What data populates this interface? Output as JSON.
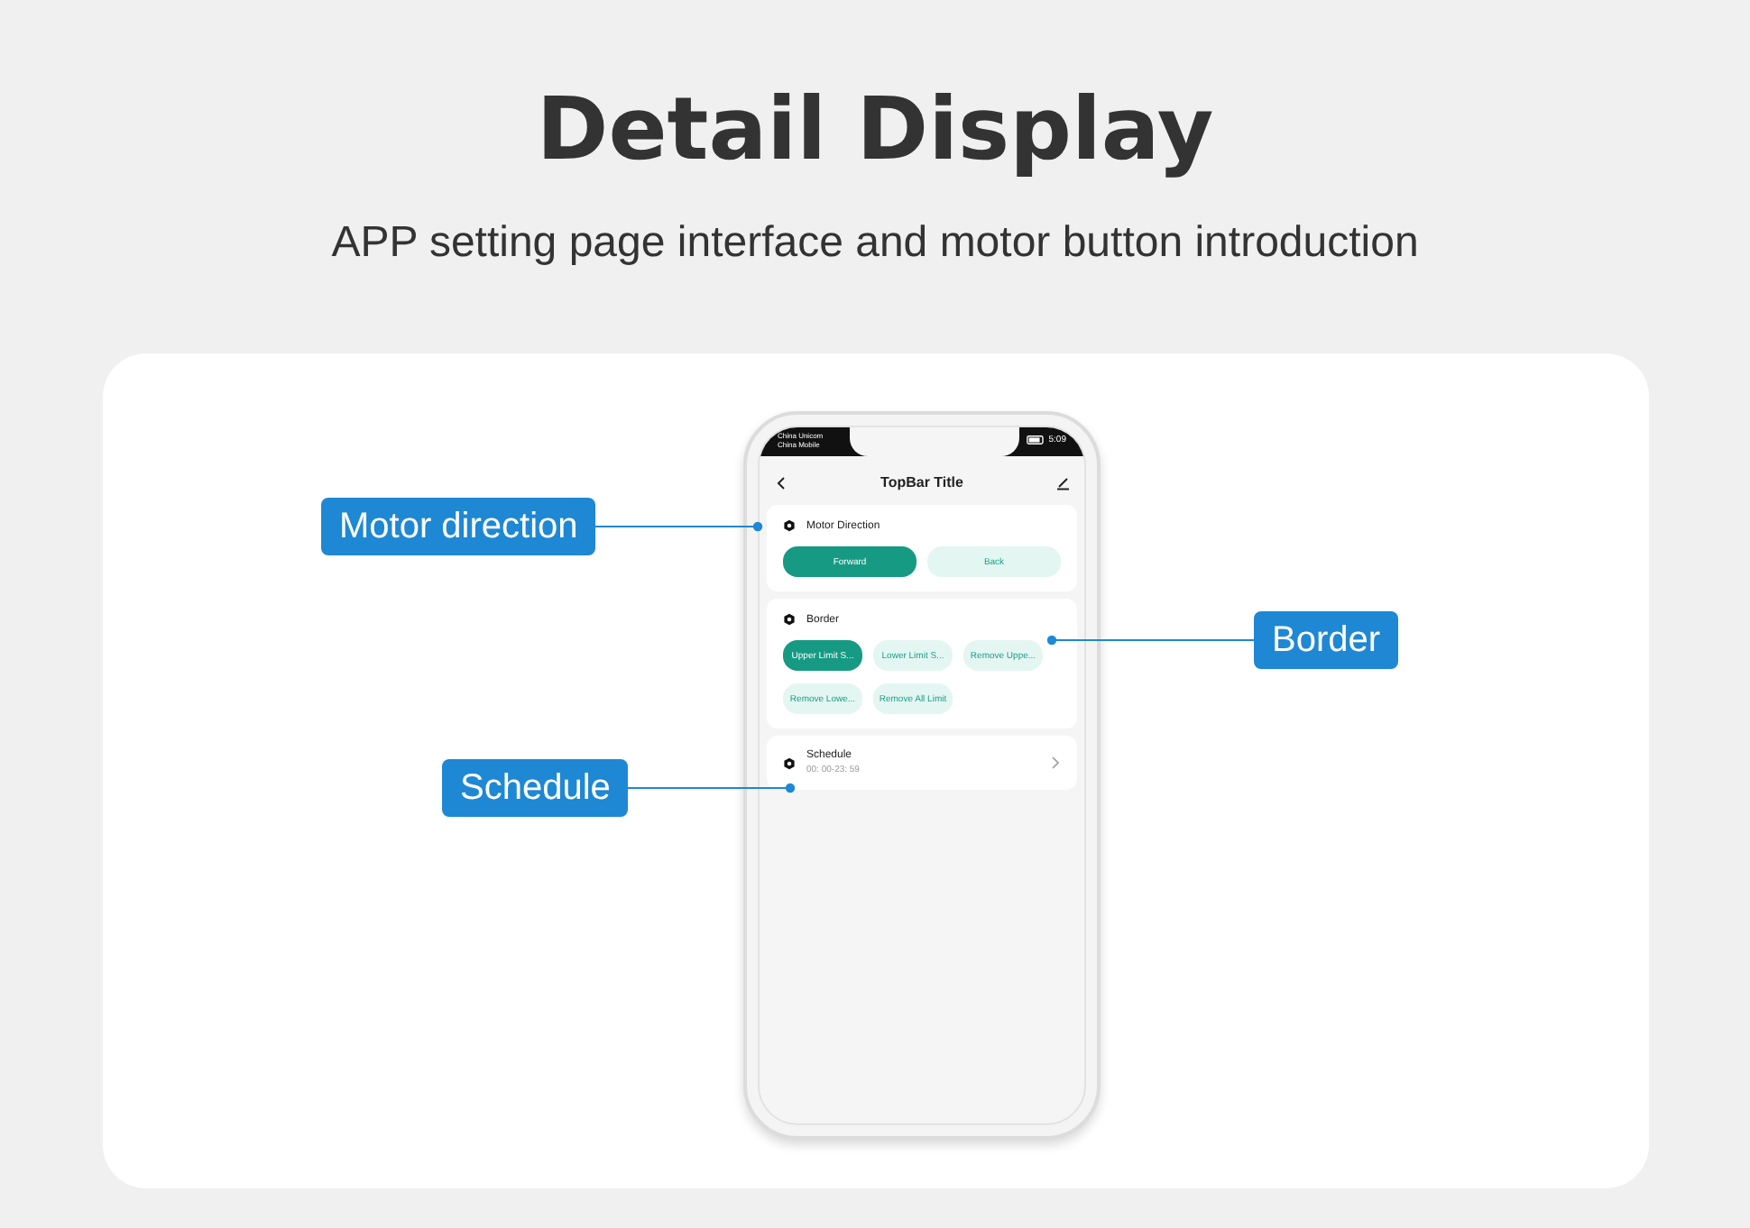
{
  "header": {
    "title": "Detail Display",
    "subtitle": "APP setting page interface and motor button introduction"
  },
  "callouts": [
    {
      "label": "Motor direction",
      "kind": "left"
    },
    {
      "label": "Border",
      "kind": "right"
    },
    {
      "label": "Schedule",
      "kind": "left"
    }
  ],
  "phone": {
    "status_bar": {
      "carriers": [
        "China Unicom",
        "China Mobile"
      ],
      "time": "5:09"
    },
    "top_bar": {
      "title": "TopBar Title"
    },
    "sections": [
      {
        "kind": "choice",
        "title": "Motor Direction",
        "buttons": [
          {
            "label": "Forward",
            "selected": true
          },
          {
            "label": "Back",
            "selected": false
          }
        ]
      },
      {
        "kind": "choice",
        "title": "Border",
        "buttons": [
          {
            "label": "Upper Limit S...",
            "selected": true
          },
          {
            "label": "Lower Limit S...",
            "selected": false
          },
          {
            "label": "Remove Uppe...",
            "selected": false
          },
          {
            "label": "Remove Lowe...",
            "selected": false
          },
          {
            "label": "Remove All Limit",
            "selected": false
          }
        ]
      },
      {
        "kind": "link",
        "title": "Schedule",
        "value": "00: 00-23: 59"
      }
    ]
  }
}
